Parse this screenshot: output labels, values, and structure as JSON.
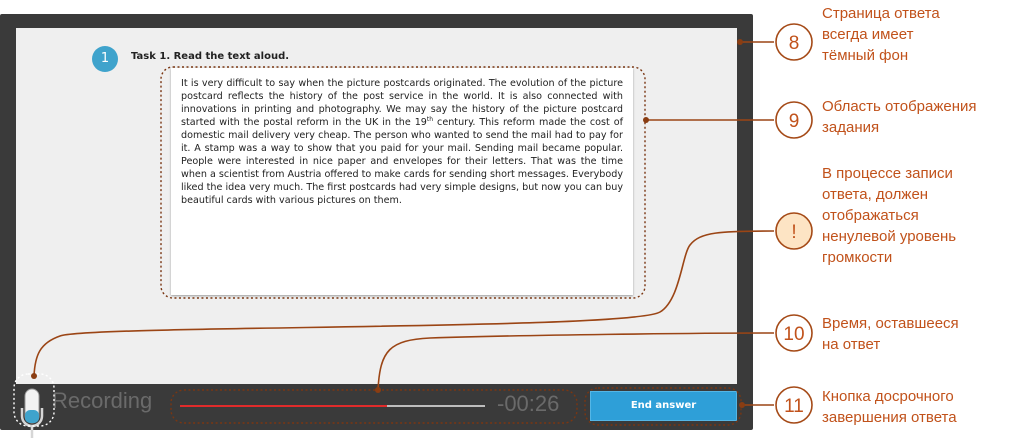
{
  "task": {
    "number": "1",
    "title": "Task 1. Read the text aloud.",
    "text_before_sup": "It is very difficult to say when the picture postcards originated. The evolution of the picture postcard reflects the history of the post service in the world. It is also connected with innovations in printing and photography. We may say the history of the picture postcard started with the postal reform in the UK in the 19",
    "sup": "th",
    "text_after_sup": " century. This reform made the cost of domestic mail delivery very cheap. The person who wanted to send the mail had to pay for it. A stamp was a way to show that you paid for your mail. Sending mail became popular. People were interested in nice paper and envelopes for their letters. That was the time when a scientist from Austria offered to make cards for sending short messages. Everybody liked the idea very much. The first postcards had very simple designs, but now you can buy beautiful cards with various pictures on them."
  },
  "recorder": {
    "status_label": "Recording",
    "timer": "-00:26",
    "progress_fraction": 0.68,
    "end_button_label": "End answer"
  },
  "colors": {
    "accent": "#3fa3cc",
    "annotation": "#c1521b",
    "progress": "#e02b2b",
    "button": "#2e9fd8"
  },
  "annotations": [
    {
      "badge": "8",
      "text": [
        "Страница ответа",
        "всегда имеет",
        "тёмный фон"
      ]
    },
    {
      "badge": "9",
      "text": [
        "Область отображения",
        "задания"
      ]
    },
    {
      "badge": "!",
      "text": [
        "В процессе записи",
        "ответа, должен",
        "отображаться",
        "ненулевой уровень",
        "громкости"
      ]
    },
    {
      "badge": "10",
      "text": [
        "Время, оставшееся",
        "на ответ"
      ]
    },
    {
      "badge": "11",
      "text": [
        "Кнопка досрочного",
        "завершения ответа"
      ]
    }
  ]
}
